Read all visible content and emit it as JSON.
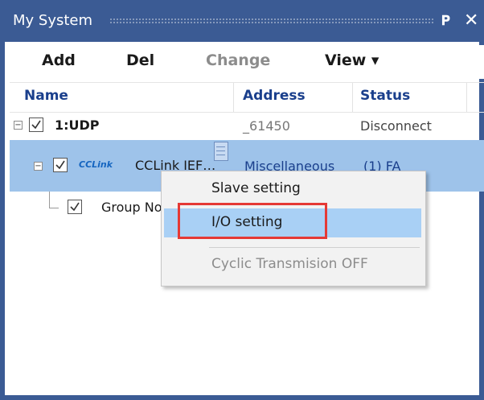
{
  "window": {
    "title": "My System"
  },
  "toolbar": {
    "add_label": "Add",
    "del_label": "Del",
    "change_label": "Change",
    "view_label": "View ▾"
  },
  "columns": {
    "name": "Name",
    "address": "Address",
    "status": "Status"
  },
  "tree": [
    {
      "name": "1:UDP",
      "address": "_61450",
      "status": "Disconnect",
      "checked": true,
      "expanded": true
    },
    {
      "logo_text": "CCLink",
      "name": "CCLink IEF…",
      "address": "Miscellaneous",
      "status": "(1) FA",
      "checked": true,
      "expanded": true,
      "selected": true
    },
    {
      "name": "Group No",
      "checked": true
    }
  ],
  "context_menu": {
    "items": [
      {
        "label": "Slave setting",
        "enabled": true
      },
      {
        "label": "I/O setting",
        "enabled": true,
        "hovered": true
      },
      {
        "label": "Cyclic Transmision OFF",
        "enabled": false
      }
    ]
  },
  "colors": {
    "title_bar": "#3b5b94",
    "selection": "#9ec3ea",
    "menu_hover": "#a9d0f5",
    "highlight_box": "#e53935",
    "header_text": "#1a3f8c",
    "address_blue": "#1a3f8c"
  },
  "icons": {
    "pin": "pin-icon",
    "close": "close-icon",
    "expander": "collapse-icon",
    "checkbox": "checkbox-checked-icon",
    "device": "device-tag-icon"
  }
}
